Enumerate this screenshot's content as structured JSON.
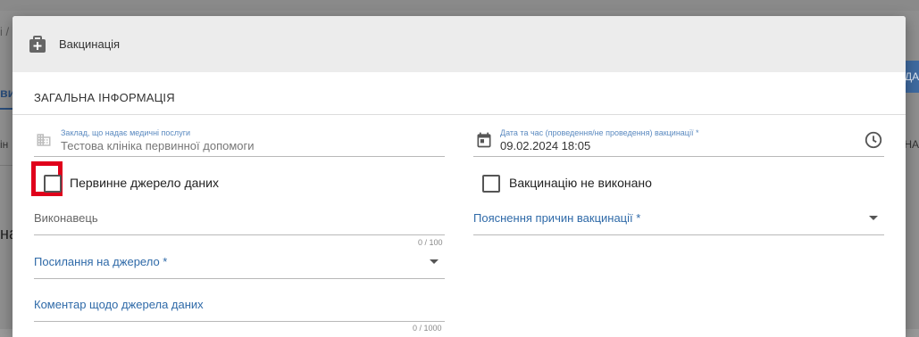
{
  "background": {
    "crumb": "і /",
    "tab": "ви",
    "col1": "ін",
    "big": "на",
    "button": "ДА",
    "col2": "НА"
  },
  "modal": {
    "title": "Вакцинація",
    "header_icon": "medical-case-icon",
    "section_title": "ЗАГАЛЬНА ІНФОРМАЦІЯ",
    "facility": {
      "icon": "building-icon",
      "label": "Заклад, що надає медичні послуги",
      "value": "Тестова клініка первинної допомоги"
    },
    "date": {
      "icon": "calendar-icon",
      "label": "Дата та час (проведення/не проведення) вакцинації *",
      "value": "09.02.2024 18:05",
      "time_icon": "clock-icon"
    },
    "primary_source": {
      "label": "Первинне джерело даних",
      "checked": false
    },
    "not_done": {
      "label": "Вакцинацію не виконано",
      "checked": false
    },
    "performer": {
      "placeholder": "Виконавець",
      "counter": "0 / 100"
    },
    "reason": {
      "label": "Пояснення причин вакцинації *"
    },
    "source_link": {
      "label": "Посилання на джерело *"
    },
    "source_comment": {
      "label": "Коментар щодо джерела даних",
      "counter": "0 / 1000"
    }
  },
  "colors": {
    "accent": "#2f6aa8",
    "highlight": "#e0001b",
    "header_bg": "#ececec"
  }
}
